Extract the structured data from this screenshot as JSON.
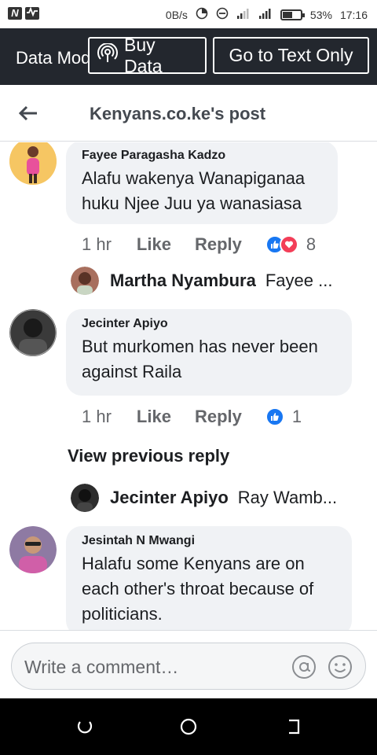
{
  "status_bar": {
    "left_icons": [
      "N",
      "pulse-icon"
    ],
    "speed": "0B/s",
    "battery": "53%",
    "battery_level": 0.53,
    "time": "17:16"
  },
  "data_bar": {
    "label": "Data Mode",
    "buy_data": "Buy Data",
    "text_only": "Go to Text Only"
  },
  "header": {
    "title": "Kenyans.co.ke's post"
  },
  "comments": [
    {
      "name": "Fayee Paragasha Kadzo",
      "text_lines": [
        "Alafu wakenya Wanapiganaa",
        "huku Njee Juu ya wanasiasa"
      ],
      "time": "1 hr",
      "like": "Like",
      "reply": "Reply",
      "reaction_count": "8",
      "reactions": [
        "like",
        "love"
      ]
    },
    {
      "name": "Jecinter Apiyo",
      "text_lines": [
        "But murkomen has never been",
        "against Raila"
      ],
      "time": "1 hr",
      "like": "Like",
      "reply": "Reply",
      "reaction_count": "1",
      "reactions": [
        "like"
      ]
    },
    {
      "name": "Jesintah N Mwangi",
      "text_lines": [
        "Halafu some Kenyans are on",
        "each other's throat because of",
        "politicians."
      ]
    }
  ],
  "replies": [
    {
      "name": "Martha Nyambura",
      "preview": "Fayee ..."
    },
    {
      "name": "Jecinter Apiyo",
      "preview": "Ray Wamb..."
    }
  ],
  "view_previous_reply": "View previous reply",
  "composer": {
    "placeholder": "Write a comment…"
  },
  "colors": {
    "data_bar_bg": "#23272e",
    "bubble_bg": "#f0f2f5",
    "like_blue": "#1877f2",
    "love_red": "#f33e58"
  }
}
